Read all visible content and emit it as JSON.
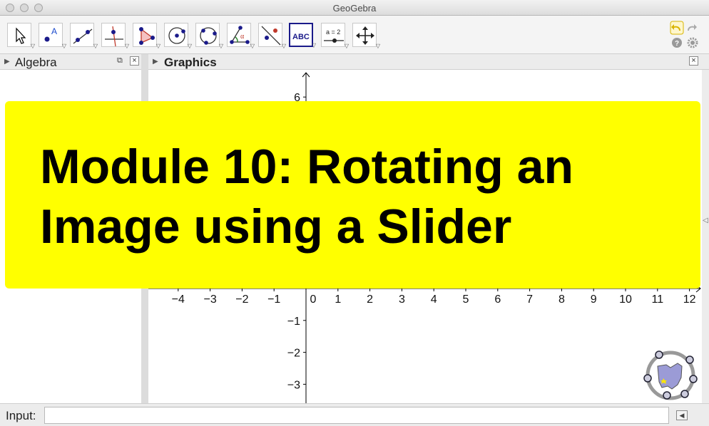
{
  "window": {
    "title": "GeoGebra"
  },
  "toolbar": {
    "tools": [
      {
        "name": "move-tool"
      },
      {
        "name": "new-point-tool",
        "glyph": "A"
      },
      {
        "name": "line-tool"
      },
      {
        "name": "perpendicular-line-tool"
      },
      {
        "name": "polygon-tool"
      },
      {
        "name": "circle-center-point-tool"
      },
      {
        "name": "circle-three-points-tool"
      },
      {
        "name": "angle-tool",
        "glyph": "α"
      },
      {
        "name": "reflect-tool"
      },
      {
        "name": "text-tool",
        "glyph": "ABC",
        "selected": true
      },
      {
        "name": "slider-tool",
        "glyph": "a = 2"
      },
      {
        "name": "move-graphics-view-tool"
      }
    ]
  },
  "algebra_panel": {
    "label": "Algebra"
  },
  "graphics_panel": {
    "label": "Graphics",
    "x_tick_labels": [
      "−4",
      "−3",
      "−2",
      "−1",
      "0",
      "1",
      "2",
      "3",
      "4",
      "5",
      "6",
      "7",
      "8",
      "9",
      "10",
      "11",
      "12"
    ],
    "y_tick_labels": [
      "6",
      "−1",
      "−2",
      "−3"
    ]
  },
  "banner": {
    "line1": "Module 10: Rotating an",
    "line2": "Image using a Slider",
    "color": "#ffff00"
  },
  "input_bar": {
    "label": "Input:",
    "value": ""
  },
  "colors": {
    "accent_selected": "#1a1a8a",
    "undo_icon": "#d9b400",
    "logo_fill": "#9b9bd6"
  }
}
